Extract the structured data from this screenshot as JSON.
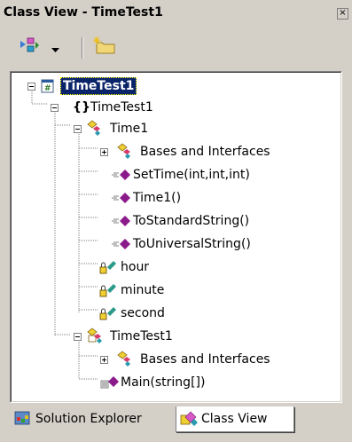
{
  "window": {
    "title": "Class View - TimeTest1",
    "close_glyph": "×"
  },
  "toolbar": {
    "sort_button_icon": "sort-by-type-icon",
    "dropdown_icon": "dropdown-arrow-icon",
    "new_folder_icon": "new-folder-icon"
  },
  "tree": {
    "project": "TimeTest1",
    "namespace_brace": "{}",
    "namespace": "TimeTest1",
    "class1": "Time1",
    "class1_bases": "Bases and Interfaces",
    "method1": "SetTime(int,int,int)",
    "method2": "Time1()",
    "method3": "ToStandardString()",
    "method4": "ToUniversalString()",
    "field1": "hour",
    "field2": "minute",
    "field3": "second",
    "class2": "TimeTest1",
    "class2_bases": "Bases and Interfaces",
    "method5": "Main(string[])"
  },
  "tabs": {
    "solution_explorer": "Solution Explorer",
    "class_view": "Class View",
    "active": "Class View"
  },
  "colors": {
    "chrome": "#d4d0c8",
    "selection": "#0a246a",
    "method_purple": "#8b1a8b",
    "class_yellow": "#f0d030",
    "field_teal": "#2a9a8a"
  }
}
